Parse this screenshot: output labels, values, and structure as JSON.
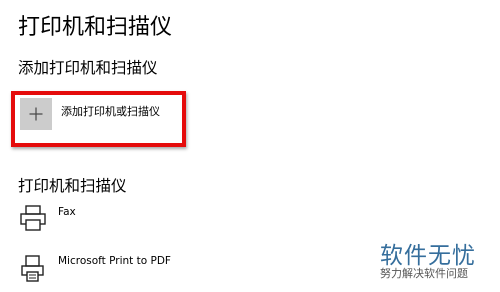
{
  "page": {
    "title": "打印机和扫描仪"
  },
  "add_section": {
    "heading": "添加打印机和扫描仪",
    "add_button_label": "添加打印机或扫描仪",
    "add_icon": "plus-icon"
  },
  "devices_section": {
    "heading": "打印机和扫描仪",
    "devices": [
      {
        "name": "Fax",
        "icon": "fax-printer-icon"
      },
      {
        "name": "Microsoft Print to PDF",
        "icon": "pdf-printer-icon"
      }
    ]
  },
  "watermark": {
    "title": "软件无忧",
    "subtitle": "努力解决软件问题"
  },
  "colors": {
    "highlight_border": "#e50b0b",
    "add_tile_bg": "#cccccc",
    "watermark": "#356e9c"
  }
}
